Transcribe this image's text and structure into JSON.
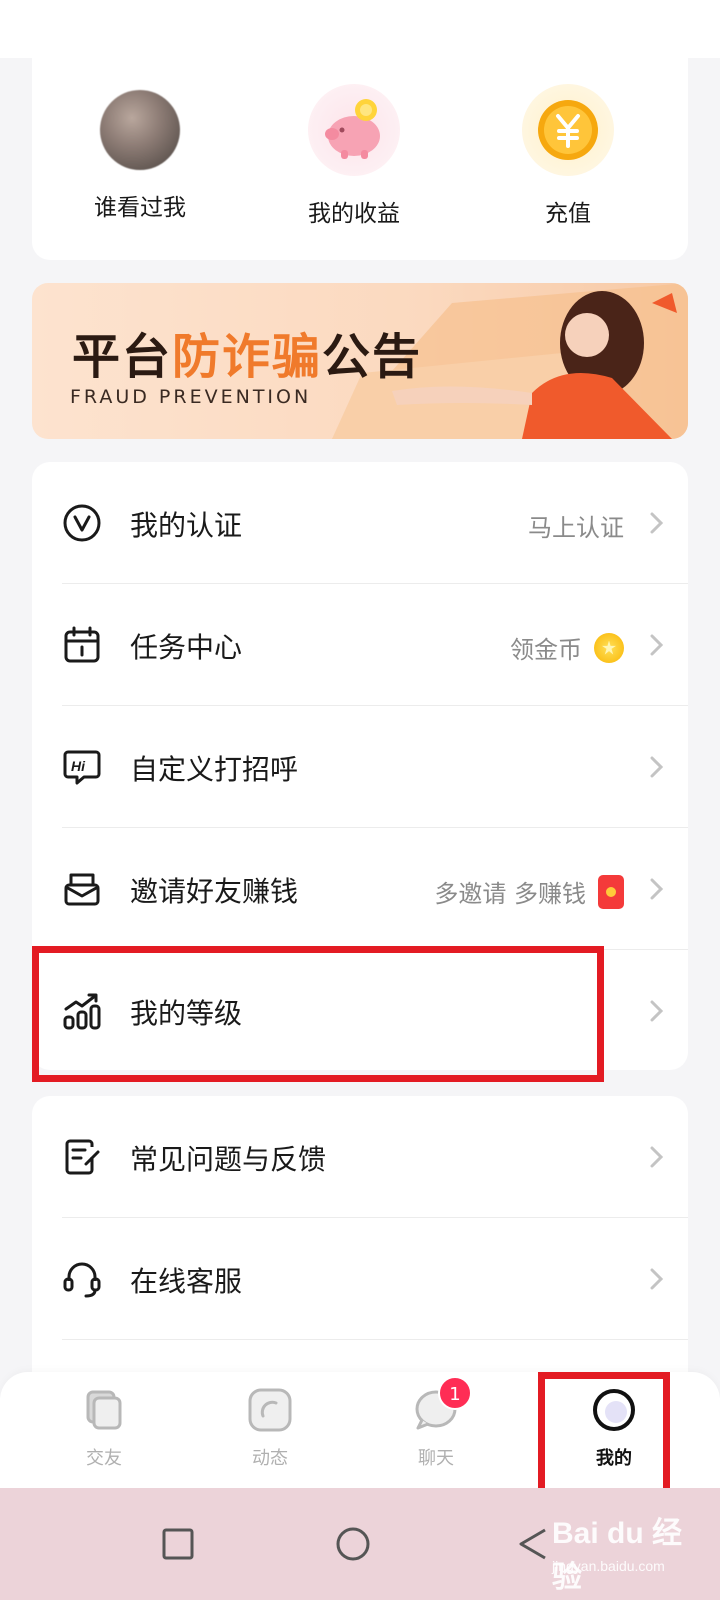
{
  "quick_actions": [
    {
      "label": "谁看过我",
      "icon": "avatar-icon"
    },
    {
      "label": "我的收益",
      "icon": "piggy-bank-icon"
    },
    {
      "label": "充值",
      "icon": "coin-yuan-icon"
    }
  ],
  "banner": {
    "title_a": "平台",
    "title_highlight": "防诈骗",
    "title_b": "公告",
    "subtitle": "FRAUD PREVENTION"
  },
  "menu_group_1": [
    {
      "label": "我的认证",
      "hint": "马上认证",
      "icon": "verified-icon"
    },
    {
      "label": "任务中心",
      "hint": "领金币",
      "icon": "calendar-icon"
    },
    {
      "label": "自定义打招呼",
      "hint": "",
      "icon": "hi-chat-icon"
    },
    {
      "label": "邀请好友赚钱",
      "hint": "多邀请 多赚钱",
      "icon": "envelope-icon"
    },
    {
      "label": "我的等级",
      "hint": "",
      "icon": "level-chart-icon"
    }
  ],
  "menu_group_2": [
    {
      "label": "常见问题与反馈",
      "icon": "feedback-icon"
    },
    {
      "label": "在线客服",
      "icon": "headset-icon"
    }
  ],
  "bottom_nav": [
    {
      "label": "交友",
      "icon": "cards-icon",
      "active": false
    },
    {
      "label": "动态",
      "icon": "moments-icon",
      "active": false
    },
    {
      "label": "聊天",
      "icon": "chat-bubble-icon",
      "active": false,
      "badge": "1"
    },
    {
      "label": "我的",
      "icon": "profile-circle-icon",
      "active": true
    }
  ],
  "watermark": {
    "main": "Bai du 经验",
    "sub": "jingyan.baidu.com"
  },
  "colors": {
    "accent_red": "#e31b23",
    "badge": "#ff2d55",
    "banner_highlight": "#f07a2b"
  }
}
